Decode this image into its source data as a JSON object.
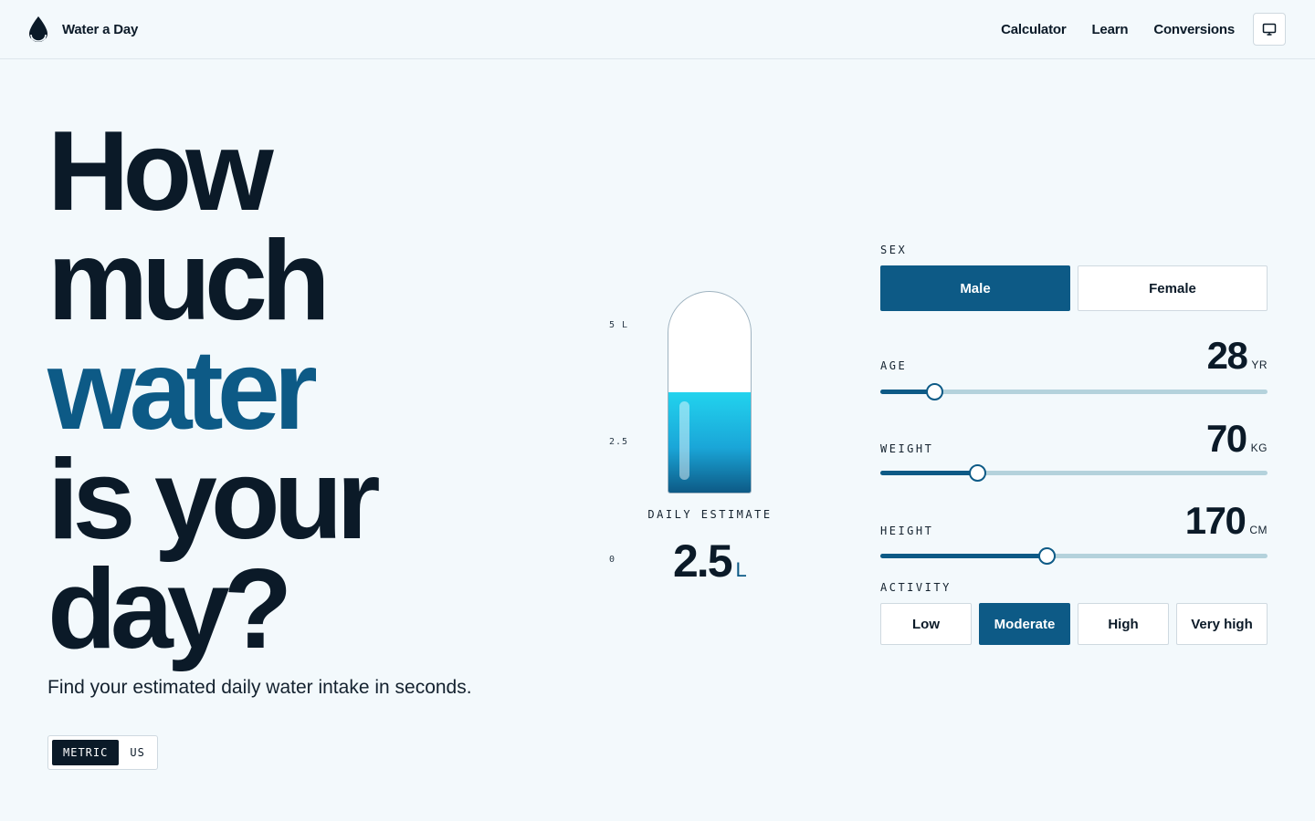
{
  "header": {
    "brand": "Water a Day",
    "nav": [
      {
        "label": "Calculator"
      },
      {
        "label": "Learn"
      },
      {
        "label": "Conversions"
      }
    ],
    "theme_icon": "monitor-icon",
    "brand_icon": "water-drop-icon"
  },
  "hero": {
    "line1": "How",
    "line2": "much",
    "line3": "water",
    "line4": "is your",
    "line5": "day?",
    "subtitle": "Find your estimated daily water intake in seconds."
  },
  "units": {
    "options": [
      "METRIC",
      "US"
    ],
    "selected": "METRIC"
  },
  "gauge": {
    "tick_top": "5 L",
    "tick_mid": "2.5",
    "tick_bottom": "0",
    "caption": "DAILY ESTIMATE",
    "value": "2.5",
    "unit": "L",
    "fill_fraction": 0.5
  },
  "controls": {
    "sex": {
      "label": "SEX",
      "options": [
        "Male",
        "Female"
      ],
      "selected": "Male"
    },
    "age": {
      "label": "AGE",
      "value": "28",
      "unit": "YR",
      "level": 0.14
    },
    "weight": {
      "label": "WEIGHT",
      "value": "70",
      "unit": "KG",
      "level": 0.25
    },
    "height": {
      "label": "HEIGHT",
      "value": "170",
      "unit": "CM",
      "level": 0.43
    },
    "activity": {
      "label": "ACTIVITY",
      "options": [
        "Low",
        "Moderate",
        "High",
        "Very high"
      ],
      "selected": "Moderate"
    }
  },
  "colors": {
    "accent": "#0d5a86",
    "text": "#0b1a28",
    "background": "#f3f9fc",
    "water_light": "#22d3ee"
  }
}
